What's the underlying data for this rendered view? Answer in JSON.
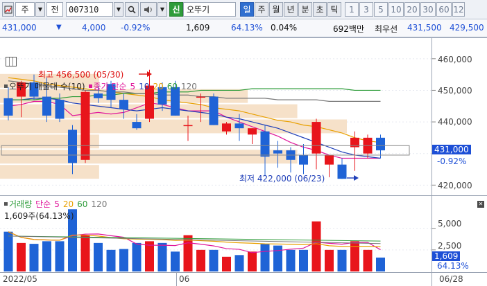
{
  "toolbar": {
    "market_btn": "주",
    "prev_btn": "전",
    "code": "007310",
    "name": "오뚜기",
    "name_tag": "신",
    "periods": [
      "일",
      "주",
      "월",
      "년",
      "분",
      "초",
      "틱"
    ],
    "active_period": "일",
    "numbers": [
      "1",
      "3",
      "5",
      "10",
      "20",
      "30",
      "60",
      "12"
    ]
  },
  "info": {
    "price": "431,000",
    "change_arrow": "▼",
    "change": "4,000",
    "change_pct": "-0.92%",
    "volume": "1,609",
    "volume_ratio": "64.13%",
    "turnover_pct": "0.04%",
    "amount": "692백만",
    "best_label": "최우선",
    "bid": "431,500",
    "ask": "429,500"
  },
  "price_panel": {
    "legend_title": "오뚜기 매물대 수(10)",
    "legend_ma": "종가 단순",
    "ma_periods": [
      "5",
      "10",
      "20",
      "60",
      "120"
    ],
    "ma_colors": [
      "#e0149a",
      "#1f3fb8",
      "#e8a000",
      "#2e9c3a",
      "#777777"
    ],
    "y_ticks": [
      "460,000",
      "450,000",
      "440,000",
      "420,000"
    ],
    "current_price": "431,000",
    "current_pct": "-0.92%",
    "high_label": "최고 456,500 (05/30)",
    "low_label": "최저 422,000 (06/23)"
  },
  "volume_panel": {
    "legend_title": "거래량",
    "legend_ma": "단순",
    "ma_periods": [
      "5",
      "20",
      "60",
      "120"
    ],
    "sub_label": "1,609주(64.13%)",
    "y_ticks": [
      "5,000",
      "2,500"
    ],
    "current_volume": "1,609",
    "current_pct": "64.13%"
  },
  "dates": {
    "start": "2022/05",
    "mid": "06",
    "end": "06/28"
  },
  "colors": {
    "up": "#e8151b",
    "down": "#1f63d6",
    "volume_profile": "#f6e1c9"
  },
  "chart_data": [
    {
      "type": "candlestick",
      "title": "오뚜기",
      "y_range": [
        417000,
        465000
      ],
      "candles": [
        {
          "o": 447500,
          "h": 451000,
          "l": 440500,
          "c": 442000
        },
        {
          "o": 448000,
          "h": 453000,
          "l": 441500,
          "c": 452500
        },
        {
          "o": 452500,
          "h": 455000,
          "l": 447000,
          "c": 448000
        },
        {
          "o": 448000,
          "h": 454000,
          "l": 440000,
          "c": 442000
        },
        {
          "o": 447000,
          "h": 449000,
          "l": 440000,
          "c": 441000
        },
        {
          "o": 437500,
          "h": 439000,
          "l": 423500,
          "c": 427000
        },
        {
          "o": 428000,
          "h": 450000,
          "l": 427000,
          "c": 449500
        },
        {
          "o": 449000,
          "h": 451500,
          "l": 446000,
          "c": 447500
        },
        {
          "o": 452000,
          "h": 453000,
          "l": 444500,
          "c": 447000
        },
        {
          "o": 447000,
          "h": 449000,
          "l": 441000,
          "c": 444000
        },
        {
          "o": 440000,
          "h": 442500,
          "l": 437500,
          "c": 438000
        },
        {
          "o": 441000,
          "h": 456500,
          "l": 440000,
          "c": 451500
        },
        {
          "o": 451000,
          "h": 452500,
          "l": 443500,
          "c": 445500
        },
        {
          "o": 451000,
          "h": 453000,
          "l": 442000,
          "c": 442000
        },
        {
          "o": 439000,
          "h": 442000,
          "l": 434000,
          "c": 439000
        },
        {
          "o": 448000,
          "h": 449000,
          "l": 440000,
          "c": 448000
        },
        {
          "o": 448000,
          "h": 449000,
          "l": 439000,
          "c": 439000
        },
        {
          "o": 437000,
          "h": 440000,
          "l": 436000,
          "c": 439500
        },
        {
          "o": 439500,
          "h": 442500,
          "l": 434000,
          "c": 438000
        },
        {
          "o": 436000,
          "h": 438000,
          "l": 433000,
          "c": 438000
        },
        {
          "o": 437000,
          "h": 439000,
          "l": 423000,
          "c": 429000
        },
        {
          "o": 431000,
          "h": 434000,
          "l": 425500,
          "c": 430000
        },
        {
          "o": 431000,
          "h": 432000,
          "l": 424000,
          "c": 428000
        },
        {
          "o": 429500,
          "h": 433000,
          "l": 423500,
          "c": 426500
        },
        {
          "o": 430000,
          "h": 441000,
          "l": 425000,
          "c": 440000
        },
        {
          "o": 426500,
          "h": 429500,
          "l": 422500,
          "c": 429500
        },
        {
          "o": 426500,
          "h": 428500,
          "l": 422000,
          "c": 422000
        },
        {
          "o": 432000,
          "h": 437000,
          "l": 424500,
          "c": 435000
        },
        {
          "o": 430000,
          "h": 436000,
          "l": 428500,
          "c": 435000
        },
        {
          "o": 435000,
          "h": 436000,
          "l": 428500,
          "c": 431000
        }
      ],
      "ma": [
        {
          "period": "5",
          "values": [
            445000,
            445500,
            446500,
            446500,
            445500,
            442000,
            442500,
            443000,
            442500,
            443000,
            444500,
            446000,
            445500,
            444500,
            443500,
            443500,
            443500,
            441500,
            440000,
            438500,
            437000,
            435500,
            433500,
            432000,
            431000,
            429500,
            428500,
            428500,
            428500,
            428500
          ]
        },
        {
          "period": "10",
          "values": [
            447000,
            447000,
            447500,
            447500,
            447000,
            446000,
            445500,
            445000,
            444500,
            444000,
            443500,
            444000,
            444500,
            444000,
            443500,
            443000,
            442500,
            441500,
            441000,
            440000,
            439000,
            438000,
            436500,
            435000,
            433500,
            432000,
            430500,
            429500,
            429000,
            428500
          ]
        },
        {
          "period": "20",
          "values": [
            454000,
            453500,
            453000,
            452000,
            451500,
            451000,
            450500,
            450000,
            449500,
            449000,
            448500,
            448000,
            447000,
            446500,
            446000,
            445500,
            444500,
            444000,
            443500,
            442500,
            441500,
            440500,
            440000,
            439000,
            438500,
            437500,
            436500,
            435000,
            434000,
            433500
          ]
        },
        {
          "period": "60",
          "values": [
            447000,
            447000,
            447000,
            447500,
            447500,
            448000,
            448000,
            448500,
            448500,
            449000,
            449000,
            449000,
            449500,
            449500,
            449500,
            450000,
            450000,
            450000,
            450000,
            450500,
            450500,
            450500,
            450500,
            450500,
            450500,
            450500,
            450500,
            450000,
            450000,
            450000
          ]
        },
        {
          "period": "120",
          "values": [
            453000,
            452500,
            452000,
            451500,
            451000,
            450500,
            450000,
            450000,
            449500,
            449500,
            449000,
            449000,
            448500,
            448500,
            448500,
            448000,
            448000,
            447500,
            447500,
            447500,
            447500,
            447000,
            447000,
            447000,
            447000,
            446500,
            446500,
            446500,
            446500,
            446500
          ]
        }
      ]
    },
    {
      "type": "bar",
      "title": "거래량",
      "y_range": [
        0,
        7700
      ],
      "values": [
        4600,
        3300,
        3200,
        3500,
        3500,
        7200,
        4200,
        3300,
        2500,
        2600,
        3300,
        3500,
        3300,
        2300,
        4200,
        2500,
        2500,
        1700,
        1900,
        2300,
        3200,
        3000,
        2500,
        2500,
        5800,
        2500,
        2500,
        3500,
        2500,
        1609
      ]
    }
  ]
}
